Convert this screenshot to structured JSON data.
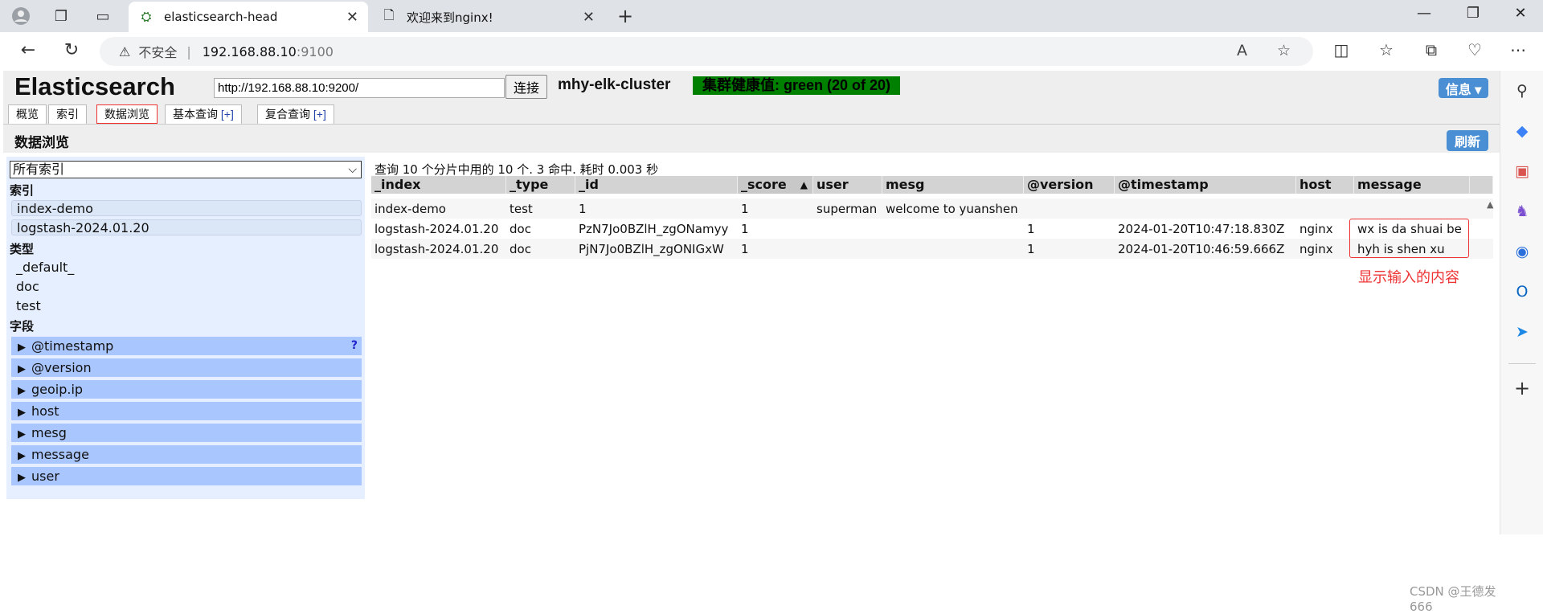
{
  "browser": {
    "tabs": [
      {
        "label": "elasticsearch-head",
        "active": true
      },
      {
        "label": "欢迎来到nginx!",
        "active": false
      }
    ],
    "address": {
      "security_label": "不安全",
      "separator": "|",
      "host": "192.168.88.10",
      "port": ":9100"
    }
  },
  "app": {
    "title": "Elasticsearch",
    "url_value": "http://192.168.88.10:9200/",
    "connect_label": "连接",
    "cluster_name": "mhy-elk-cluster",
    "health": "集群健康值: green (20 of 20)",
    "health_color": "#008000",
    "info_label": "信息 ▾",
    "nav_tabs": [
      {
        "label": "概览",
        "plus": ""
      },
      {
        "label": "索引",
        "plus": ""
      },
      {
        "label": "数据浏览",
        "plus": ""
      },
      {
        "label": "基本查询 ",
        "plus": "[+]"
      },
      {
        "label": "复合查询 ",
        "plus": "[+]"
      }
    ],
    "active_tab": "数据浏览"
  },
  "browser_view": {
    "title": "数据浏览",
    "refresh_label": "刷新"
  },
  "filter": {
    "select_value": "所有索引",
    "index_heading": "索引",
    "indices": [
      "index-demo",
      "logstash-2024.01.20"
    ],
    "type_heading": "类型",
    "types": [
      "_default_",
      "doc",
      "test"
    ],
    "field_heading": "字段",
    "fields": [
      "@timestamp",
      "@version",
      "geoip.ip",
      "host",
      "mesg",
      "message",
      "user"
    ],
    "help_label": "?"
  },
  "results": {
    "query_info": "查询 10 个分片中用的 10 个. 3 命中. 耗时 0.003 秒",
    "columns": [
      "_index",
      "_type",
      "_id",
      "_score",
      "user",
      "mesg",
      "@version",
      "@timestamp",
      "host",
      "message"
    ],
    "sort_indicator": "▲",
    "sorted_column": "_score",
    "rows": [
      [
        "index-demo",
        "test",
        "1",
        "1",
        "superman",
        "welcome to yuanshen",
        "",
        "",
        "",
        ""
      ],
      [
        "logstash-2024.01.20",
        "doc",
        "PzN7Jo0BZlH_zgONamyy",
        "1",
        "",
        "",
        "1",
        "2024-01-20T10:47:18.830Z",
        "nginx",
        "wx is da shuai be"
      ],
      [
        "logstash-2024.01.20",
        "doc",
        "PjN7Jo0BZlH_zgONIGxW",
        "1",
        "",
        "",
        "1",
        "2024-01-20T10:46:59.666Z",
        "nginx",
        "hyh is shen xu"
      ]
    ]
  },
  "annotation": "显示输入的内容",
  "watermark": "CSDN @王德发666"
}
